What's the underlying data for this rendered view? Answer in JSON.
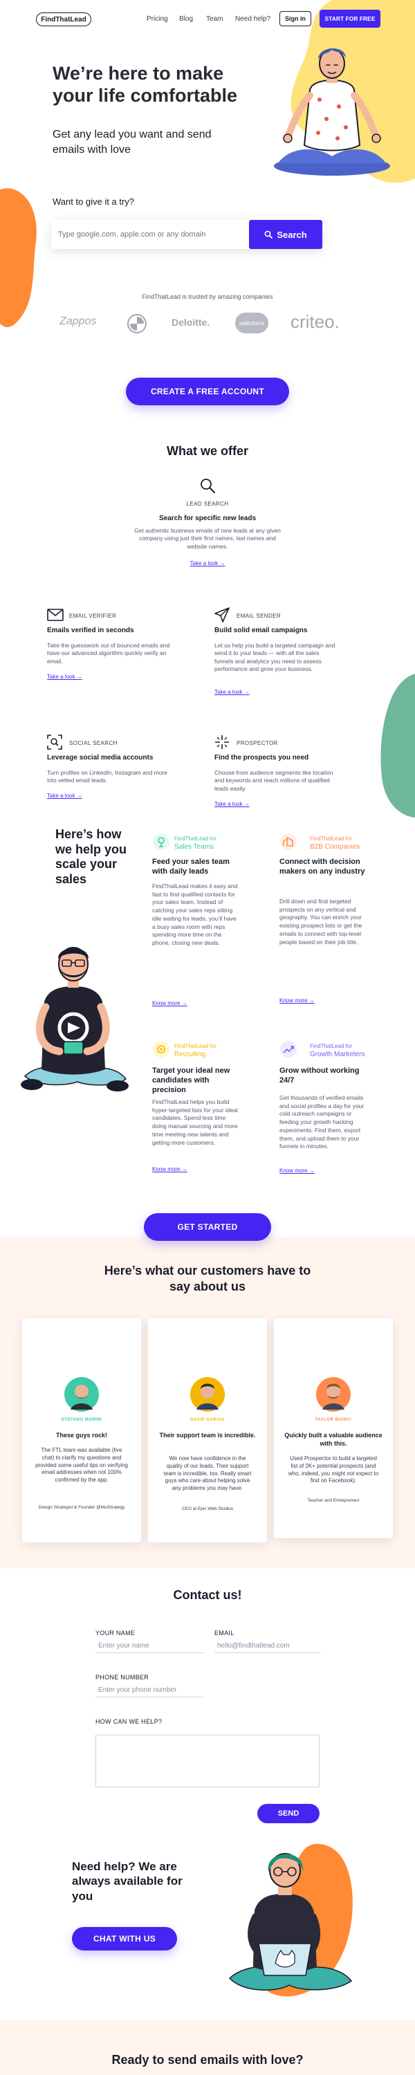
{
  "nav": {
    "logo": "FindThatLead",
    "links": [
      "Pricing",
      "Blog",
      "Team",
      "Need help?"
    ],
    "signin_label": "Sign in",
    "cta_label": "START FOR FREE"
  },
  "hero": {
    "title": "We’re here to make your life comfortable",
    "subtitle": "Get any lead you want and send emails with love",
    "try_label": "Want to give it a try?",
    "search_placeholder": "Type google.com, apple.com or any domain",
    "search_button": "Search"
  },
  "trusted": {
    "text": "FindThatLead is trusted by amazing companies",
    "logos": [
      "Zappos",
      "BMW",
      "Deloitte.",
      "salesforce",
      "criteo."
    ]
  },
  "cta_account": "CREATE A FREE ACCOUNT",
  "offer": {
    "heading": "What we offer",
    "features": [
      {
        "icon": "magnifier-icon",
        "tag": "LEAD SEARCH",
        "title": "Search for specific new leads",
        "desc": "Get authentic business emails of new leads at any given company using just their first names, last names and website names.",
        "link": "Take a look →"
      },
      {
        "icon": "envelope-icon",
        "tag": "EMAIL VERIFIER",
        "title": "Emails verified in seconds",
        "desc": "Take the guesswork out of bounced emails and have our advanced algorithm quickly verify an email.",
        "link": "Take a look →"
      },
      {
        "icon": "paper-plane-icon",
        "tag": "EMAIL SENDER",
        "title": "Build solid email campaigns",
        "desc": "Let us help you build a targeted campaign and send it to your leads — with all the sales funnels and analytics you need to assess performance and grow your business.",
        "link": "Take a look →"
      },
      {
        "icon": "social-search-icon",
        "tag": "SOCIAL SEARCH",
        "title": "Leverage social media accounts",
        "desc": "Turn profiles on LinkedIn, Instagram and more into vetted email leads.",
        "link": "Take a look →"
      },
      {
        "icon": "prospector-icon",
        "tag": "PROSPECTOR",
        "title": "Find the prospects you need",
        "desc": "Choose from audience segments like location and keywords and reach millions of qualified leads easily.",
        "link": "Take a look →"
      }
    ]
  },
  "help": {
    "heading": "Here’s how we help you scale your sales",
    "items": [
      {
        "small": "FindThatLead for",
        "team": "Sales Teams",
        "color": "#3ec9a7",
        "title": "Feed your sales team with daily leads",
        "desc": "FindThatLead makes it easy and fast to find qualified contacts for your sales team. Instead of catching your sales reps sitting idle waiting for leads, you’ll have a busy sales room with reps spending more time on the phone, closing new deals.",
        "link": "Know more →"
      },
      {
        "small": "FindThatLead for",
        "team": "B2B Companies",
        "color": "#ff8a4c",
        "title": "Connect with decision makers on any industry",
        "desc": "Drill down and find targeted prospects on any vertical and geography. You can enrich your existing prospect lists or get the emails to connect with top-level people based on their job title.",
        "link": "Know more →"
      },
      {
        "small": "FindThatLead for",
        "team": "Recruiting",
        "color": "#f5c400",
        "title": "Target your ideal new candidates with precision",
        "desc": "FindThatLead helps you build hyper-targeted lists for your ideal candidates. Spend less time doing manual sourcing and more time meeting new talents and getting more customers.",
        "link": "Know more →"
      },
      {
        "small": "FindThatLead for",
        "team": "Growth Marketers",
        "color": "#7b5cf5",
        "title": "Grow without working 24/7",
        "desc": "Get thousands of verified emails and social profiles a day for your cold outreach campaigns or feeding your growth hacking experiments. Find them, export them, and upload them to your funnels in minutes.",
        "link": "Know more →"
      }
    ]
  },
  "cta_start": "GET STARTED",
  "testimonials": {
    "heading": "Here’s what our customers have to say about us",
    "items": [
      {
        "name": "STEFANO MORINI",
        "color": "#3ec9a7",
        "head": "These guys rock!",
        "body": "The FTL team was available (live chat) to clarify my questions and provided some useful tips on verifying email addresses when not 100% confirmed by the app.",
        "role": "Design Strategist & Founder @MuiStrategy"
      },
      {
        "name": "DAVID GARCIA",
        "color": "#f5b400",
        "head": "Their support team is incredible.",
        "body": "We now have confidence in the quality of our leads. Their support team is incredible, too. Really smart guys who care about helping solve any problems you may have.",
        "role": "CEO at Epic Web Studios"
      },
      {
        "name": "TAYLOR BIANCI",
        "color": "#ff8a4c",
        "head": "Quickly built a valuable audience with this.",
        "body": "Used Prospector to build a targeted list of 2K+ potential prospects (and who, indeed, you might not expect to find on Facebook).",
        "role": "Teacher and Entrepreneur"
      }
    ]
  },
  "contact": {
    "heading": "Contact us!",
    "name_label": "YOUR NAME",
    "name_placeholder": "Enter your name",
    "email_label": "EMAIL",
    "email_placeholder": "hello@findthatlead.com",
    "phone_label": "PHONE NUMBER",
    "phone_placeholder": "Enter your phone number",
    "help_label": "HOW CAN WE HELP?",
    "send_label": "SEND"
  },
  "need_help": {
    "heading": "Need help? We are always available for you",
    "chat_label": "CHAT WITH US"
  },
  "bottom": {
    "heading": "Ready to send emails with love?"
  },
  "colors": {
    "accent": "#4525f2",
    "yellow": "#ffe27a",
    "orange": "#ff8a33",
    "teal": "#6fb79a",
    "peach": "#fff5ee"
  }
}
